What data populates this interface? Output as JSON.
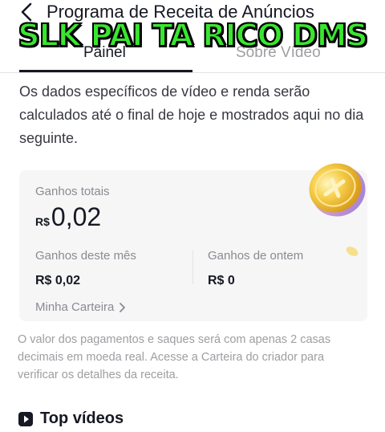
{
  "header": {
    "title": "Programa de Receita de Anúncios",
    "back_icon": "chevron-left-icon"
  },
  "overlay": {
    "caption": "SLK PAI TA RICO DMS",
    "color": "#39e62f"
  },
  "tabs": [
    {
      "label": "Painel",
      "active": true
    },
    {
      "label": "Sobre Vídeo",
      "active": false
    }
  ],
  "info": {
    "text": "Os dados específicos de vídeo e renda serão calculados até o final de hoje e mostrados aqui no dia seguinte."
  },
  "earnings": {
    "total_label": "Ganhos totais",
    "total_currency": "R$",
    "total_amount": "0,02",
    "month_label": "Ganhos deste mês",
    "month_value": "R$ 0,02",
    "yesterday_label": "Ganhos de ontem",
    "yesterday_value": "R$ 0",
    "wallet_link": "Minha Carteira",
    "coin_icon": "gold-coin-icon"
  },
  "note": {
    "text": "O valor dos pagamentos e saques será com apenas 2 casas decimais em moeda real. Acesse a Carteira do criador para verificar os detalhes da receita."
  },
  "top_videos": {
    "label": "Top vídeos",
    "icon": "play-icon"
  }
}
